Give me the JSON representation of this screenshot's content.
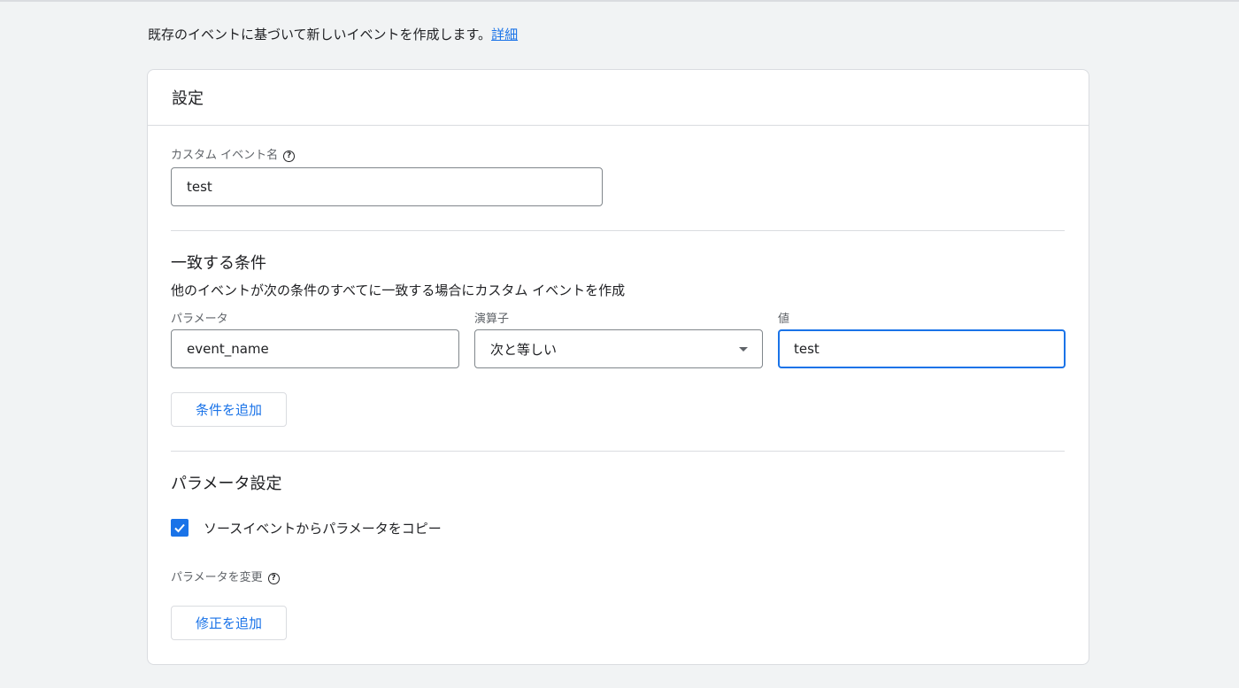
{
  "intro": {
    "text": "既存のイベントに基づいて新しいイベントを作成します。",
    "link": "詳細"
  },
  "card": {
    "title": "設定",
    "custom_event": {
      "label": "カスタム イベント名",
      "value": "test"
    },
    "conditions": {
      "title": "一致する条件",
      "description": "他のイベントが次の条件のすべてに一致する場合にカスタム イベントを作成",
      "param_label": "パラメータ",
      "param_value": "event_name",
      "operator_label": "演算子",
      "operator_value": "次と等しい",
      "value_label": "値",
      "value_value": "test",
      "add_button": "条件を追加"
    },
    "parameters": {
      "title": "パラメータ設定",
      "copy_checkbox_label": "ソースイベントからパラメータをコピー",
      "copy_checked": true,
      "modify_label": "パラメータを変更",
      "add_modification_button": "修正を追加"
    }
  },
  "colors": {
    "accent": "#1a73e8",
    "background": "#f1f3f4",
    "border": "#dadce0"
  },
  "icons": {
    "help": "help-circle-icon",
    "dropdown": "caret-down-icon",
    "check": "checkmark-icon"
  }
}
